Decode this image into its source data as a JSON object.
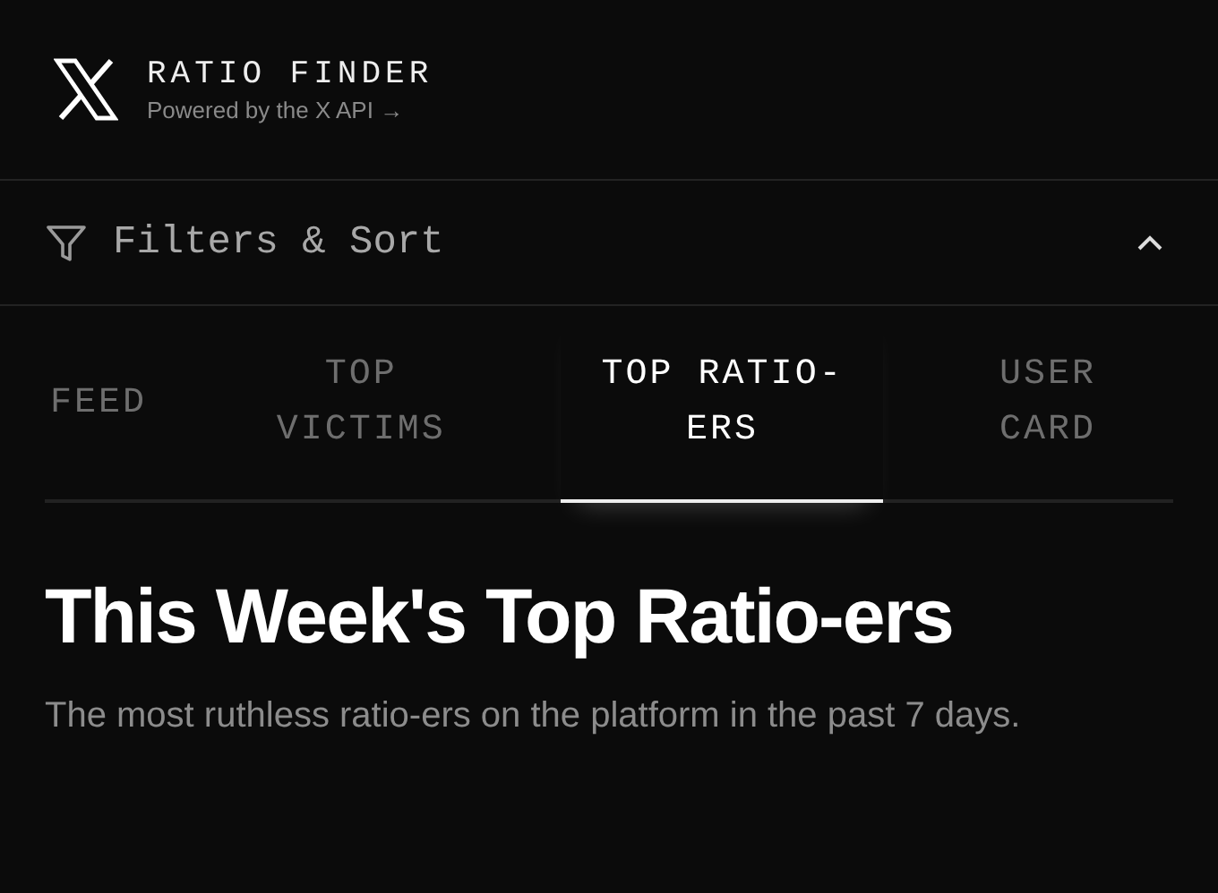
{
  "header": {
    "title": "RATIO FINDER",
    "subtitle": "Powered by the X API →"
  },
  "filters": {
    "label": "Filters & Sort",
    "expanded": true
  },
  "tabs": [
    {
      "label": "FEED",
      "selected": false
    },
    {
      "label": "TOP VICTIMS",
      "selected": false
    },
    {
      "label": "TOP RATIO-ERS",
      "selected": true
    },
    {
      "label": "USER CARD",
      "selected": false
    }
  ],
  "section": {
    "heading": "This Week's Top Ratio-ers",
    "description": "The most ruthless ratio-ers on the platform in the past 7 days."
  }
}
